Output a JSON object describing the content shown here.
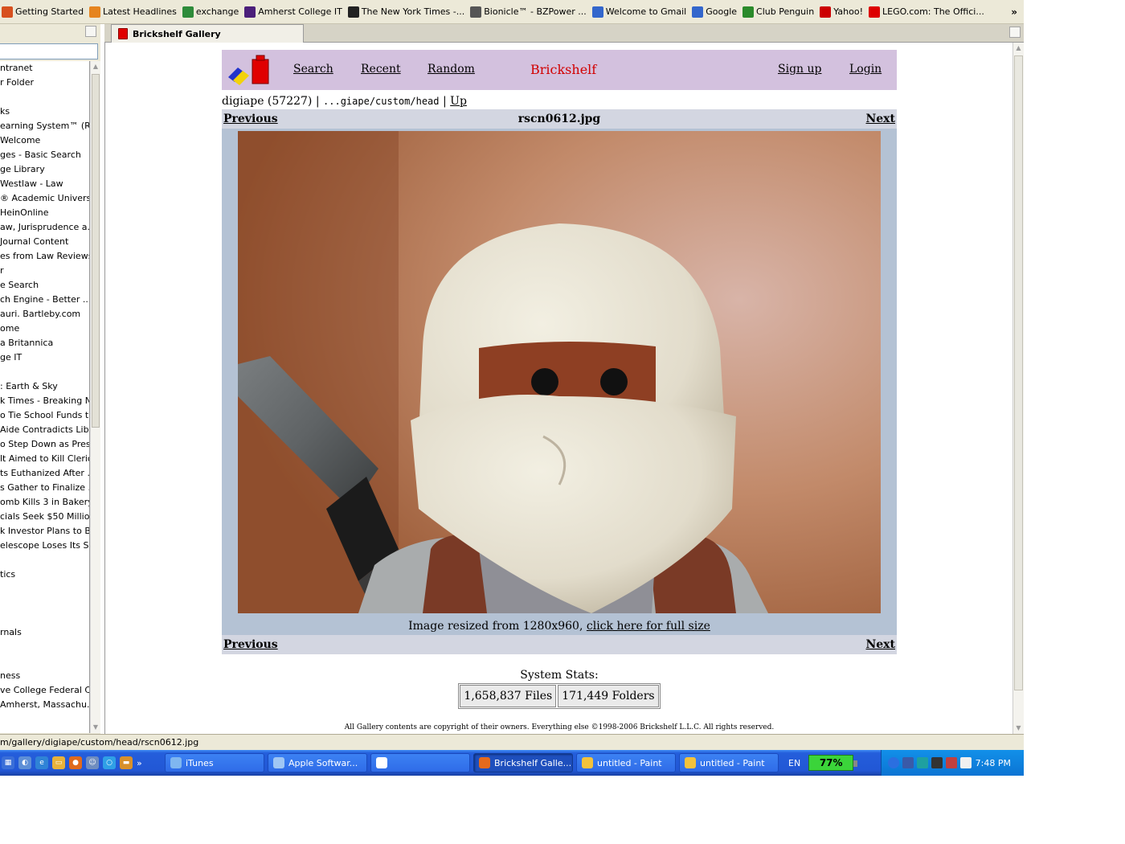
{
  "bookmarks": {
    "items": [
      {
        "label": "Getting Started",
        "icon": "firefox-icon",
        "color": "#d7501e"
      },
      {
        "label": "Latest Headlines",
        "icon": "rss-icon",
        "color": "#e6841e"
      },
      {
        "label": "exchange",
        "icon": "globe-icon",
        "color": "#2e8b3a"
      },
      {
        "label": "Amherst College IT",
        "icon": "amherst-icon",
        "color": "#4b1f7a"
      },
      {
        "label": "The New York Times -...",
        "icon": "nyt-icon",
        "color": "#222222"
      },
      {
        "label": "Bionicle™ - BZPower ...",
        "icon": "bionicle-icon",
        "color": "#555555"
      },
      {
        "label": "Welcome to Gmail",
        "icon": "google-icon",
        "color": "#3366cc"
      },
      {
        "label": "Google",
        "icon": "google-icon",
        "color": "#3366cc"
      },
      {
        "label": "Club Penguin",
        "icon": "club-penguin-icon",
        "color": "#2a8a2a"
      },
      {
        "label": "Yahoo!",
        "icon": "yahoo-icon",
        "color": "#cc0000"
      },
      {
        "label": "LEGO.com: The Offici...",
        "icon": "lego-icon",
        "color": "#dd0000"
      }
    ],
    "more": "»"
  },
  "sidebar": {
    "items": [
      "ntranet",
      "r Folder",
      "",
      "ks",
      "earning System™ (R...",
      "Welcome",
      "ges - Basic Search",
      "ge Library",
      "Westlaw - Law",
      "® Academic Univers...",
      "HeinOnline",
      "aw, Jurisprudence a...",
      "Journal Content",
      "es from Law Reviews",
      "r",
      "e Search",
      "ch Engine - Better ...",
      "auri. Bartleby.com",
      "ome",
      "a Britannica",
      "ge IT",
      "",
      ": Earth & Sky",
      "k Times - Breaking N...",
      "o Tie School Funds t...",
      "Aide Contradicts Lib...",
      "o Step Down as Presi...",
      "lt Aimed to Kill Cleric...",
      "ts Euthanized After ...",
      "s Gather to Finalize ...",
      "omb Kills 3 in Bakery...",
      "cials Seek $50 Millio...",
      "k Investor Plans to B...",
      "elescope Loses Its S...",
      "",
      "tics",
      "",
      "",
      "",
      "rnals",
      "",
      "",
      "ness",
      "ve College Federal C...",
      "Amherst, Massachu..."
    ]
  },
  "tab": {
    "title": "Brickshelf Gallery"
  },
  "page": {
    "nav": {
      "search": "Search",
      "recent": "Recent",
      "random": "Random",
      "brand": "Brickshelf",
      "signup": "Sign up",
      "login": "Login"
    },
    "crumb": {
      "user": "digiape (57227)",
      "sep1": " | ",
      "path": "...giape/custom/head",
      "sep2": " | ",
      "up": "Up"
    },
    "previous": "Previous",
    "next": "Next",
    "filename": "rscn0612.jpg",
    "resized_text": "Image resized from 1280x960, ",
    "resized_link": "click here for full size",
    "stats_label": "System Stats:",
    "files": "1,658,837 Files",
    "folders": "171,449 Folders",
    "copyright": "All Gallery contents are copyright of their owners. Everything else ©1998-2006 Brickshelf L.L.C. All rights reserved."
  },
  "status": {
    "url": "m/gallery/digiape/custom/head/rscn0612.jpg"
  },
  "taskbar": {
    "quick_more": "»",
    "tasks": [
      {
        "label": "iTunes",
        "icon": "itunes-icon",
        "active": false
      },
      {
        "label": "Apple Softwar...",
        "icon": "apple-update-icon",
        "active": false
      },
      {
        "label": "",
        "icon": "word-icon",
        "active": false
      },
      {
        "label": "Brickshelf Galle...",
        "icon": "firefox-icon",
        "active": true
      },
      {
        "label": "untitled - Paint",
        "icon": "paint-icon",
        "active": false
      },
      {
        "label": "untitled - Paint",
        "icon": "paint-icon",
        "active": false
      }
    ],
    "lang": "EN",
    "battery": "77%",
    "clock": "7:48 PM"
  }
}
